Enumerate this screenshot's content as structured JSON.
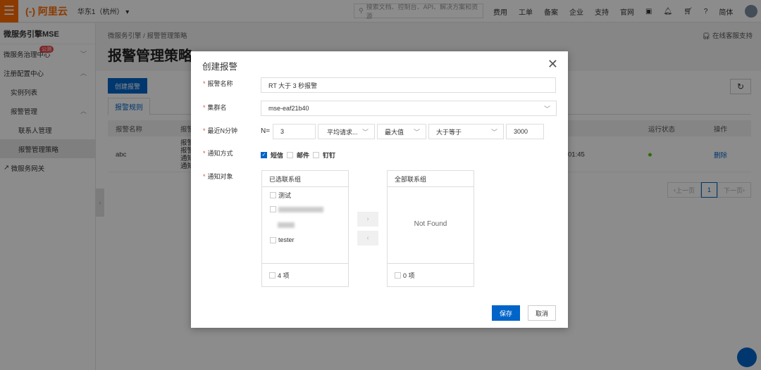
{
  "topbar": {
    "logo": "(-) 阿里云",
    "region": "华东1（杭州）",
    "search_placeholder": "搜索文档、控制台、API、解决方案和资源",
    "nav": [
      "费用",
      "工单",
      "备案",
      "企业",
      "支持",
      "官网"
    ],
    "lang": "简体"
  },
  "sidebar": {
    "title": "微服务引擎MSE",
    "items": [
      {
        "label": "微服务治理中心",
        "badge": "公测"
      },
      {
        "label": "注册配置中心"
      },
      {
        "label": "实例列表"
      },
      {
        "label": "报警管理"
      },
      {
        "label": "联系人管理"
      },
      {
        "label": "报警管理策略"
      },
      {
        "label": "微服务网关"
      }
    ]
  },
  "main": {
    "breadcrumb": [
      "微服务引擎",
      "/",
      "报警管理策略"
    ],
    "title": "报警管理策略",
    "support": "在线客服支持",
    "create_button": "创建报警",
    "tab": "报警规则",
    "columns": [
      "报警名称",
      "报警",
      "运行状态",
      "操作"
    ],
    "row": {
      "name": "abc",
      "rule_lines": [
        "报警",
        "报警",
        "通知",
        "通知"
      ],
      "time": "01:45",
      "action": "删除"
    },
    "pager": {
      "prev": "上一页",
      "current": "1",
      "next": "下一页"
    }
  },
  "modal": {
    "title": "创建报警",
    "labels": {
      "name": "报警名称",
      "cluster": "集群名",
      "window": "最近N分钟",
      "notify_method": "通知方式",
      "notify_target": "通知对象"
    },
    "name_value": "RT 大于 3 秒报警",
    "cluster_value": "mse-eaf21b40",
    "n_prefix": "N=",
    "n_value": "3",
    "metric": "平均请求...",
    "agg": "最大值",
    "op": "大于等于",
    "threshold": "3000",
    "methods": [
      {
        "label": "短信",
        "checked": true
      },
      {
        "label": "邮件",
        "checked": false
      },
      {
        "label": "钉钉",
        "checked": false
      }
    ],
    "selected_title": "已选联系组",
    "selected_items": [
      "测试",
      "tester"
    ],
    "selected_count": "4 项",
    "all_title": "全部联系组",
    "empty": "Not Found",
    "all_count": "0 项",
    "save": "保存",
    "cancel": "取消"
  },
  "colors": {
    "primary": "#0064c8",
    "brand": "#ff6a00",
    "status_ok": "#52c41a"
  }
}
